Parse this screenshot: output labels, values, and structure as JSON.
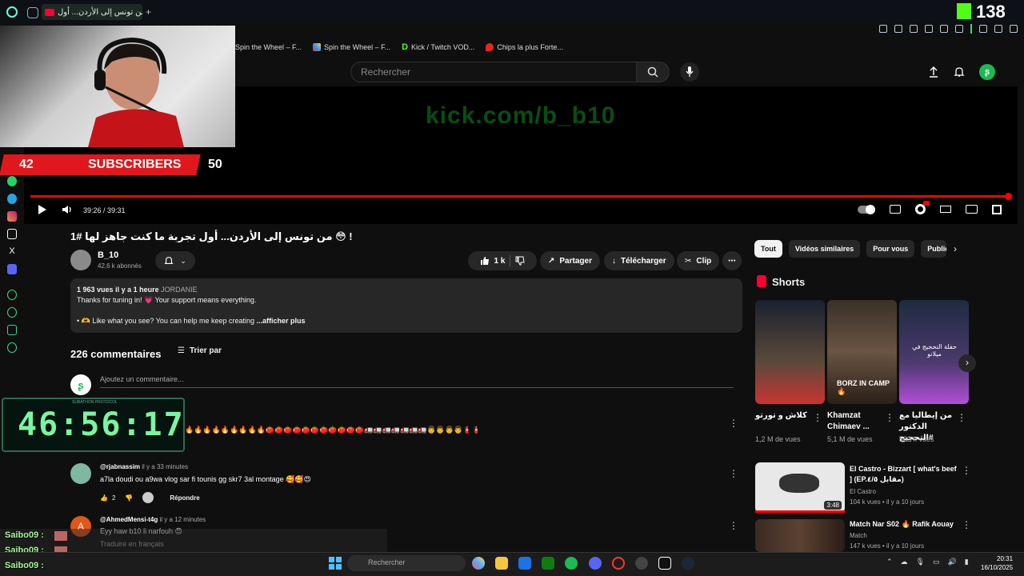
{
  "browser": {
    "tab_title": "من تونس إلى الأردن... أول 😳 !",
    "bookmarks": [
      "Spin the Wheel – F...",
      "Spin the Wheel – F...",
      "Kick / Twitch VOD...",
      "Chips la plus Forte..."
    ],
    "kick_viewers": "138"
  },
  "header": {
    "search_placeholder": "Rechercher"
  },
  "video": {
    "overlay_url": "kick.com/b_b10",
    "time": "39:26 / 39:31",
    "progress": 0.998
  },
  "stream_overlay": {
    "sub_left": "42",
    "sub_label": "SUBSCRIBERS",
    "sub_right": "50",
    "timer": "46:56:17",
    "timer_caption": "SUBATHON PROTOCOL"
  },
  "meta": {
    "title": "من تونس إلى الأردن... أول تجربة ما كنت جاهز لها #1 😳 !",
    "channel_name": "B_10",
    "channel_subs": "42,6 k abonnés",
    "likes": "1 k",
    "share": "Partager",
    "download": "Télécharger",
    "clip": "Clip"
  },
  "description": {
    "views": "1 963 vues",
    "posted": "il y a 1 heure",
    "tag": "JORDANIE",
    "line1": "Thanks for tuning in! 💗 Your support means everything.",
    "line2": "• 🫶 Like what you see? You can help me keep creating",
    "more": "...afficher plus"
  },
  "comments": {
    "count": "226 commentaires",
    "sort_label": "Trier par",
    "add_placeholder": "Ajoutez un commentaire...",
    "emoji_row": "🔥🔥🔥🔥🔥🔥🔥🔥🔥🍅🍅🍅🍅🍅🍅🍅🍅🍅🍅🍅🚛🚛🚛🚛🚛🚛🚛👨👨👨👨🧯🧯",
    "items": [
      {
        "author": "@rjabnassim",
        "time": "il y a 33 minutes",
        "text": "a7la doudi ou a9wa vlog sar fi tounis gg skr7 3al montage 🥰🥰😍",
        "likes": "2",
        "reply": "Répondre"
      },
      {
        "author": "@AhmedMensi-t4g",
        "time": "il y a 12 minutes",
        "text": "Eyy haw b10 li narfouh 😍",
        "translate": "Traduire en français"
      }
    ]
  },
  "sidebar": {
    "chips": [
      "Tout",
      "Vidéos similaires",
      "Pour vous",
      "Publiée"
    ],
    "shorts_title": "Shorts",
    "shorts": [
      {
        "caption": "كلاش و تورتو",
        "views": "1,2 M de vues"
      },
      {
        "caption": "Khamzat Chimaev ...",
        "views": "5,1 M de vues",
        "overlay": "BORZ IN CAMP 🔥"
      },
      {
        "caption": "من إيطاليا مع الدكتور #التحجيج",
        "views": "583 k vues",
        "overlay": "حفلة التحجيج في ميلانو"
      }
    ],
    "videos": [
      {
        "title": "El Castro - Bizzart [ what's beef ] (EP.مقابل ٤/٥)",
        "channel": "El Castro",
        "meta": "104 k vues • il y a 10 jours",
        "duration": "3:48"
      },
      {
        "title": "Match Nar S02 🔥 Rafik Aouay",
        "channel": "Match",
        "meta": "147 k vues • il y a 10 jours"
      }
    ]
  },
  "chat": {
    "names": [
      "Saibo09 :",
      "Saibo09 :",
      "Saibo09 :"
    ]
  },
  "taskbar": {
    "search": "Rechercher",
    "time": "20:31",
    "date": "16/10/2025"
  }
}
